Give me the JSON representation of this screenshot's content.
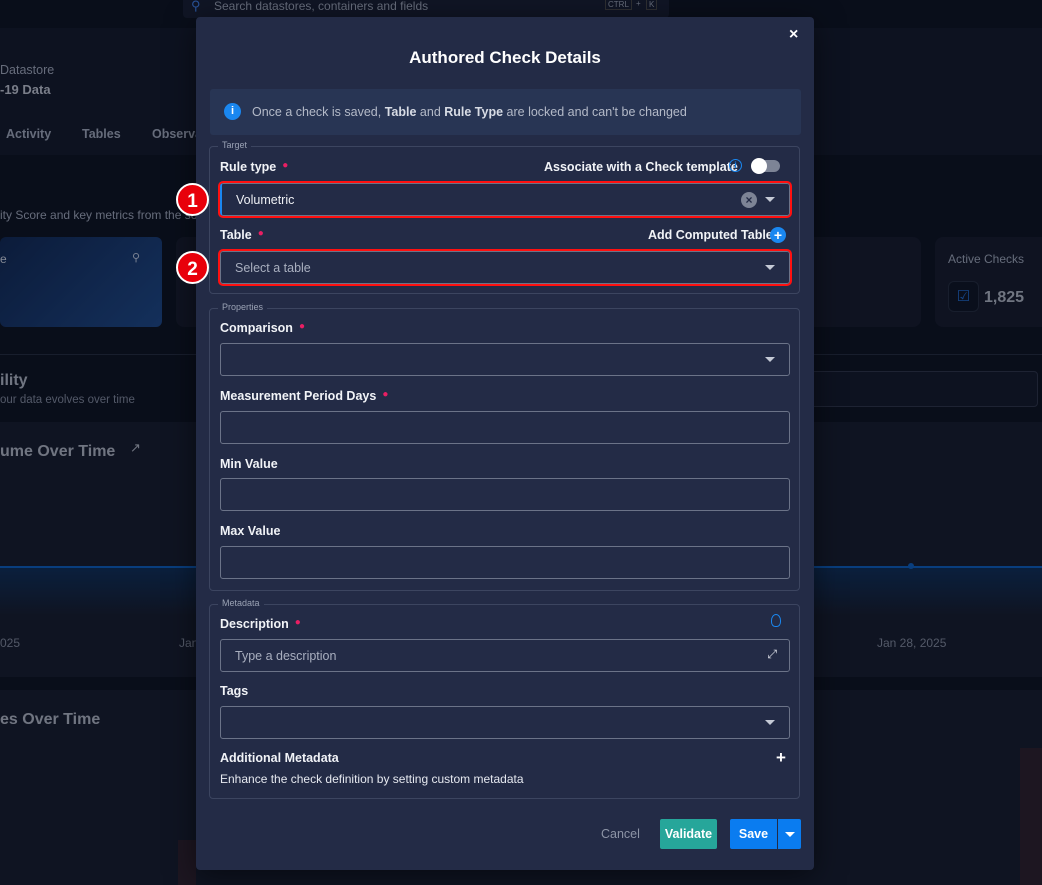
{
  "background": {
    "search_placeholder": "Search datastores, containers and fields",
    "shortcut_keys": [
      "CTRL",
      "+",
      "K"
    ],
    "datastore_label": "Datastore",
    "datastore_name": "-19 Data",
    "tabs": [
      "Activity",
      "Tables",
      "Observa"
    ],
    "subtitle": "ity Score and key metrics from the so",
    "score_card_label": "e",
    "active_checks_label": "Active Checks",
    "active_checks_value": "1,825",
    "section_title": "ility",
    "section_subtitle": "our data evolves over time",
    "chart1_title": "ume Over Time",
    "chart1_ticks": [
      "025",
      "Jan",
      "Jan 28, 2025"
    ],
    "chart2_title": "es Over Time"
  },
  "modal": {
    "title": "Authored Check Details",
    "info": {
      "pre": "Once a check is saved, ",
      "b1": "Table",
      "mid": " and ",
      "b2": "Rule Type",
      "post": " are locked and can't be changed"
    },
    "target": {
      "legend": "Target",
      "rule_type_label": "Rule type",
      "template_label": "Associate with a Check template",
      "template_toggle_on": false,
      "rule_type_value": "Volumetric",
      "table_label": "Table",
      "add_computed_label": "Add Computed Table",
      "table_placeholder": "Select a table"
    },
    "properties": {
      "legend": "Properties",
      "comparison_label": "Comparison",
      "comparison_value": "",
      "period_label": "Measurement Period Days",
      "period_value": "",
      "min_label": "Min Value",
      "min_value": "",
      "max_label": "Max Value",
      "max_value": ""
    },
    "metadata": {
      "legend": "Metadata",
      "description_label": "Description",
      "description_placeholder": "Type a description",
      "tags_label": "Tags",
      "additional_label": "Additional Metadata",
      "additional_hint": "Enhance the check definition by setting custom metadata"
    },
    "buttons": {
      "cancel": "Cancel",
      "validate": "Validate",
      "save": "Save"
    }
  },
  "annotations": [
    "1",
    "2"
  ],
  "colors": {
    "accent": "#0a7cf0",
    "validate": "#26a69a",
    "annotation": "#e8000b",
    "modal_bg": "#232b46"
  }
}
